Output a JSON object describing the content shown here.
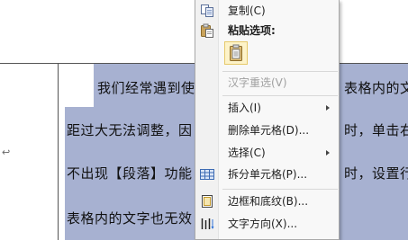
{
  "document": {
    "lines": [
      {
        "left": "我们经常遇到使",
        "right": "表格内的文"
      },
      {
        "left": "距过大无法调整，因",
        "right": "时，单击右"
      },
      {
        "left": "不出现【段落】功能",
        "right": "时，设置行"
      },
      {
        "left": "表格内的文字也无效",
        "right": ""
      }
    ],
    "paragraph_mark": "↩"
  },
  "context_menu": {
    "items": [
      {
        "id": "copy",
        "label": "复制(C)",
        "icon": "copy-icon",
        "enabled": true,
        "submenu": false
      },
      {
        "id": "paste-options",
        "label": "粘贴选项:",
        "icon": "paste-icon",
        "enabled": true,
        "submenu": false,
        "bold": true
      },
      {
        "id": "hanzi-reselect",
        "label": "汉字重选(V)",
        "icon": "",
        "enabled": false,
        "submenu": false
      },
      {
        "id": "insert",
        "label": "插入(I)",
        "icon": "",
        "enabled": true,
        "submenu": true
      },
      {
        "id": "delete-cells",
        "label": "删除单元格(D)...",
        "icon": "",
        "enabled": true,
        "submenu": false
      },
      {
        "id": "select",
        "label": "选择(C)",
        "icon": "",
        "enabled": true,
        "submenu": true
      },
      {
        "id": "split-cells",
        "label": "拆分单元格(P)...",
        "icon": "split-cells-icon",
        "enabled": true,
        "submenu": false
      },
      {
        "id": "borders-shading",
        "label": "边框和底纹(B)...",
        "icon": "borders-icon",
        "enabled": true,
        "submenu": false
      },
      {
        "id": "text-direction",
        "label": "文字方向(X)...",
        "icon": "text-direction-icon",
        "enabled": true,
        "submenu": false
      }
    ],
    "paste_option_icon": "paste-keep-text-icon"
  },
  "colors": {
    "selection": "#a7b1d1",
    "menu_background": "#f8f8f8",
    "disabled_text": "#a0a0a0"
  }
}
